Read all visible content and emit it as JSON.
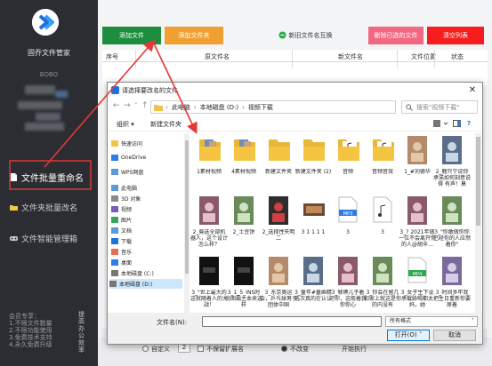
{
  "app": {
    "name": "固乔文件管家",
    "user": "BOBO",
    "menu": [
      "文件批量重命名",
      "文件夹批量改名",
      "文件智能管理箱"
    ],
    "member_lines": [
      "会员专享：",
      "1.不限文件数量",
      "2.不限功能使用",
      "3.免费技术支持",
      "4.永久免费升级"
    ],
    "vertical_text": "提高办公效率"
  },
  "toolbar": {
    "add_file": "添加文件",
    "add_folder": "添加文件夹",
    "rename_rollback": "新旧文件名互换",
    "delete_selected": "删除已选的文件",
    "clear_list": "清空列表"
  },
  "table": {
    "headers": [
      "序号",
      "原文件名",
      "新文件名",
      "文件位置",
      "状态"
    ]
  },
  "bottom": {
    "auto_label": "自定义",
    "auto_value": "2",
    "keep_label": "不保留扩展名",
    "same_label": "不改变",
    "start": "开始执行"
  },
  "dialog": {
    "title": "请选择要改名的文件",
    "path": [
      "此电脑",
      "本地磁盘 (D:)",
      "视频下载"
    ],
    "search_placeholder": "搜索\"视频下载\"",
    "organize": "组织 ▾",
    "new_folder": "新建文件夹",
    "nav_items": [
      "快速访问",
      "OneDrive",
      "WPS网盘",
      "此电脑",
      "3D 对象",
      "视频",
      "图片",
      "文档",
      "下载",
      "音乐",
      "桌面",
      "本地磁盘 (C:)",
      "本地磁盘 (D:)"
    ],
    "files": [
      "1素材视频",
      "4素材视频",
      "新建文件夹",
      "新建文件夹 (2)",
      "音频",
      "音频音效",
      "1_#刘德华",
      "2_鹿只宁说你承诺如何刻意说得 有声！莫",
      "2_竟选全部机器人，这个设计怎么样？",
      "2_土豆饼",
      "2_选择性失明二",
      "3 1 1 1 1",
      "3",
      "3",
      "3_? 2021年做一位不会离开你的人@胡辛…",
      "3_\"你敢做你你已经你的人应然着你\"",
      "3_\"世上最大的这就随着人的大战！",
      "3_1_5_INS时尚图霸主本来这样",
      "3_东京奥运会，乒乓球男子团体中国",
      "3_童年#童画精选次真的在认认",
      "3_够牌儿子着河你，这般着我你你心",
      "3_你会在留几和家上就这是你的内没有",
      "3_女子生下没承载胁喝都太妈，她",
      "3_时间多年我把生日重新你要原着"
    ],
    "filename_label": "文件名(N):",
    "filetype": "所有格式",
    "open": "打开(O)",
    "cancel": "取消"
  }
}
